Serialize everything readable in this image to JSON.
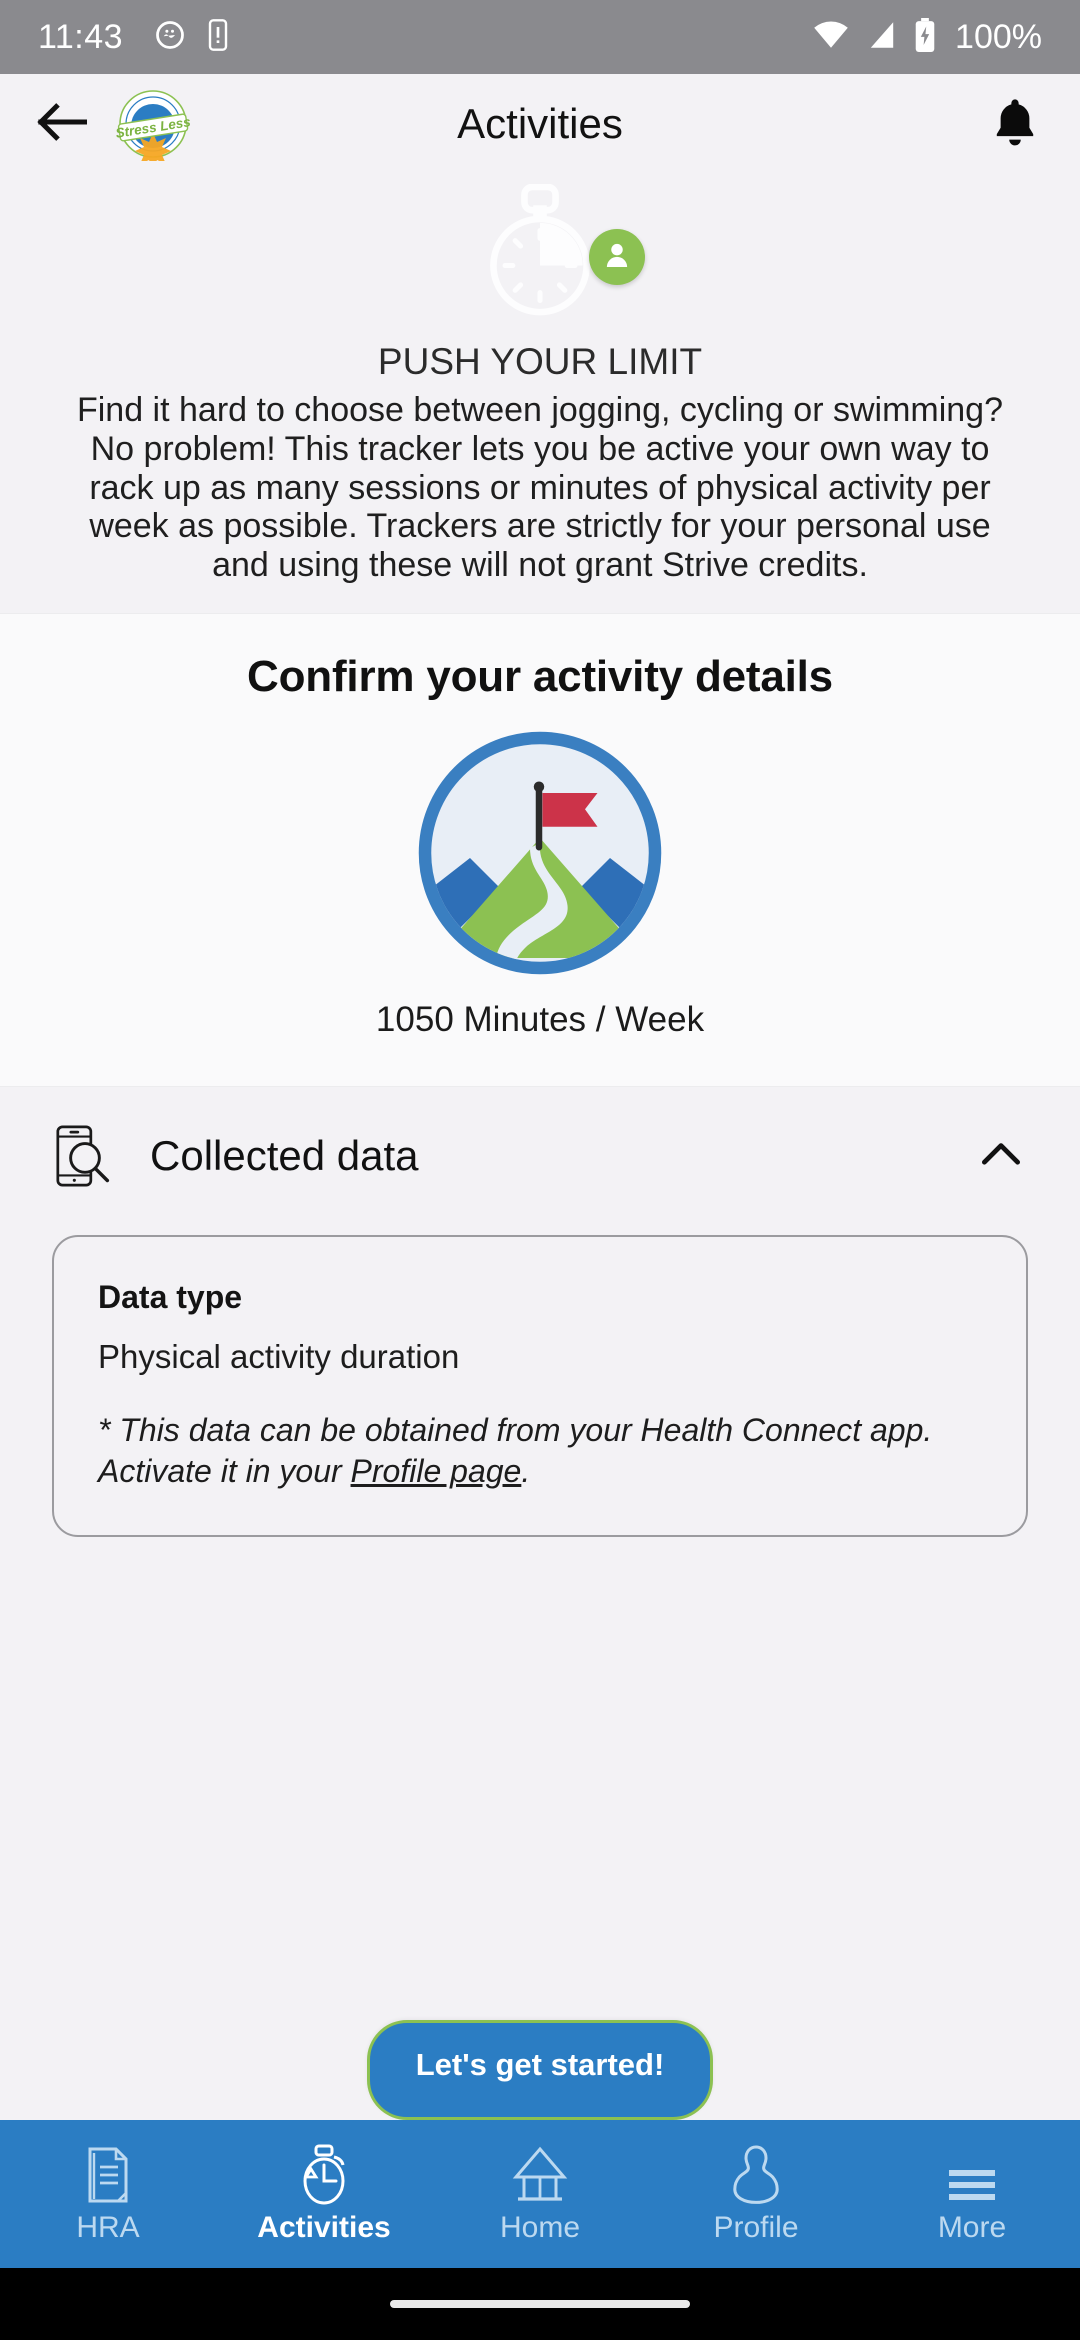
{
  "status_bar": {
    "time": "11:43",
    "battery_text": "100%",
    "icons": [
      "notification-dot-icon",
      "vibrate-phone-icon",
      "wifi-icon",
      "cellular-signal-icon",
      "battery-charging-icon"
    ]
  },
  "app_bar": {
    "back_icon": "arrow-left-icon",
    "brand_logo_text": "Stress Less",
    "title": "Activities",
    "notification_icon": "bell-icon",
    "avatar_icon": "person-icon"
  },
  "hero": {
    "icon": "stopwatch-icon",
    "title": "PUSH YOUR LIMIT",
    "description": "Find it hard to choose between jogging, cycling or swimming? No problem! This tracker lets you be active your own way to rack up as many sessions or minutes of physical activity per week as possible. Trackers are strictly for your personal use and using these will not grant Strive credits."
  },
  "confirm": {
    "heading": "Confirm your activity details",
    "goal_icon": "mountain-flag-goal-icon",
    "goal_text": "1050 Minutes / Week"
  },
  "collected_data": {
    "icon": "phone-magnifier-icon",
    "title": "Collected data",
    "chevron_icon": "chevron-up-icon",
    "expanded": true,
    "card": {
      "label": "Data type",
      "value": "Physical activity duration",
      "note_prefix": "* This data can be obtained from your Health Connect app. Activate it in your ",
      "note_link": "Profile page",
      "note_suffix": "."
    }
  },
  "cta": {
    "label": "Let's get started!"
  },
  "bottom_nav": {
    "items": [
      {
        "label": "HRA",
        "icon": "document-icon",
        "active": false
      },
      {
        "label": "Activities",
        "icon": "stopwatch-icon",
        "active": true
      },
      {
        "label": "Home",
        "icon": "home-icon",
        "active": false
      },
      {
        "label": "Profile",
        "icon": "person-icon",
        "active": false
      },
      {
        "label": "More",
        "icon": "menu-icon",
        "active": false
      }
    ]
  },
  "colors": {
    "brand_blue": "#2b7dc3",
    "accent_green": "#8cc152",
    "flag_red": "#cc3349",
    "page_bg": "#f3f2f5",
    "status_bar_bg": "#8a8a8e"
  }
}
